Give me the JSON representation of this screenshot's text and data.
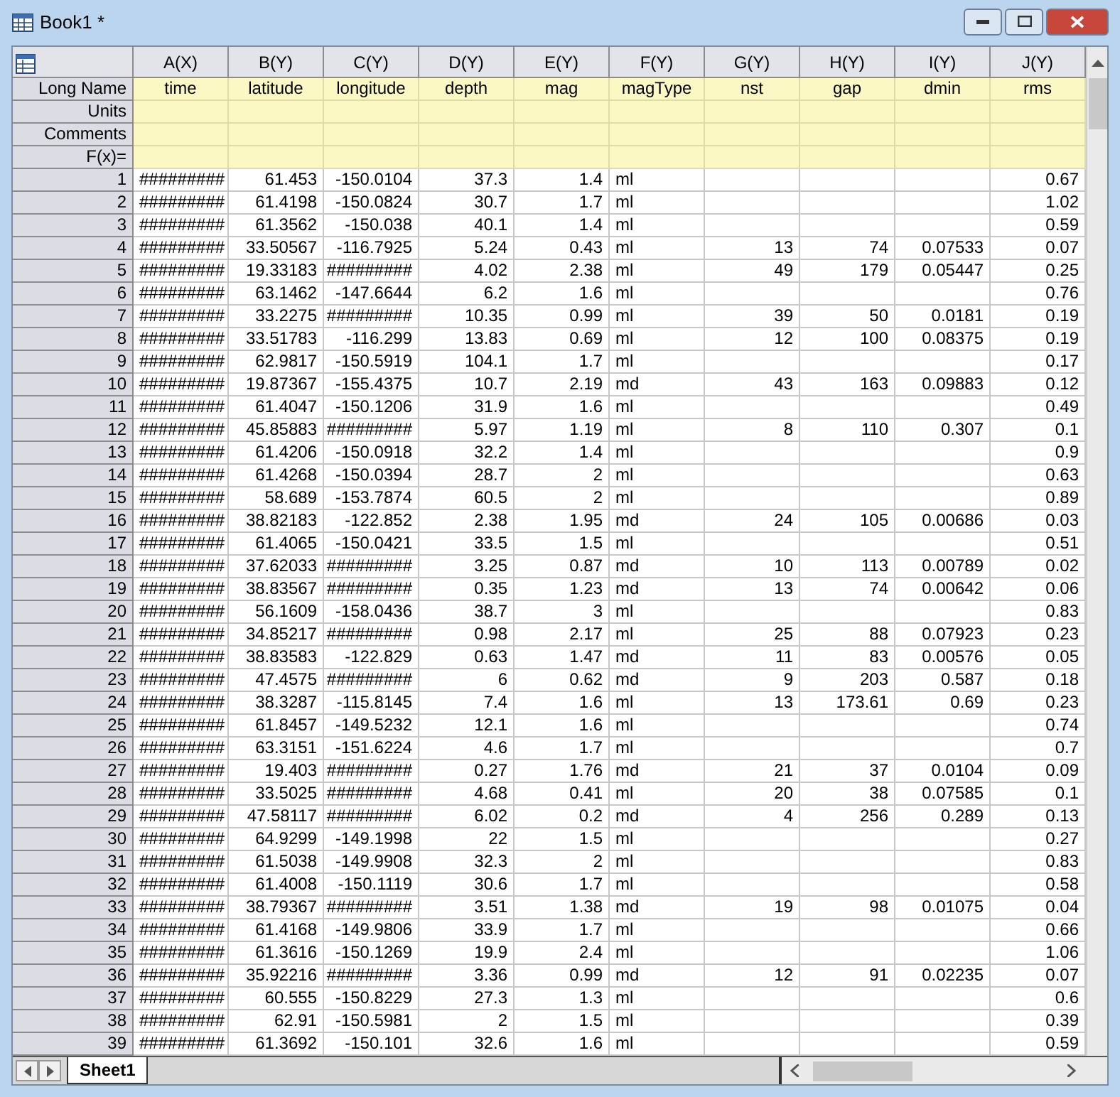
{
  "window": {
    "title": "Book1 *"
  },
  "columns": [
    {
      "name": "A(X)",
      "long_name": "time",
      "kind": "date"
    },
    {
      "name": "B(Y)",
      "long_name": "latitude",
      "kind": "number"
    },
    {
      "name": "C(Y)",
      "long_name": "longitude",
      "kind": "number"
    },
    {
      "name": "D(Y)",
      "long_name": "depth",
      "kind": "number"
    },
    {
      "name": "E(Y)",
      "long_name": "mag",
      "kind": "number"
    },
    {
      "name": "F(Y)",
      "long_name": "magType",
      "kind": "text"
    },
    {
      "name": "G(Y)",
      "long_name": "nst",
      "kind": "number"
    },
    {
      "name": "H(Y)",
      "long_name": "gap",
      "kind": "number"
    },
    {
      "name": "I(Y)",
      "long_name": "dmin",
      "kind": "number"
    },
    {
      "name": "J(Y)",
      "long_name": "rms",
      "kind": "number"
    }
  ],
  "label_rows": [
    "Long Name",
    "Units",
    "Comments",
    "F(x)="
  ],
  "rows": [
    {
      "n": "1",
      "cells": [
        "#########",
        "61.453",
        "-150.0104",
        "37.3",
        "1.4",
        "ml",
        null,
        null,
        null,
        "0.67"
      ]
    },
    {
      "n": "2",
      "cells": [
        "#########",
        "61.4198",
        "-150.0824",
        "30.7",
        "1.7",
        "ml",
        null,
        null,
        null,
        "1.02"
      ]
    },
    {
      "n": "3",
      "cells": [
        "#########",
        "61.3562",
        "-150.038",
        "40.1",
        "1.4",
        "ml",
        null,
        null,
        null,
        "0.59"
      ]
    },
    {
      "n": "4",
      "cells": [
        "#########",
        "33.50567",
        "-116.7925",
        "5.24",
        "0.43",
        "ml",
        "13",
        "74",
        "0.07533",
        "0.07"
      ]
    },
    {
      "n": "5",
      "cells": [
        "#########",
        "19.33183",
        "#########",
        "4.02",
        "2.38",
        "ml",
        "49",
        "179",
        "0.05447",
        "0.25"
      ]
    },
    {
      "n": "6",
      "cells": [
        "#########",
        "63.1462",
        "-147.6644",
        "6.2",
        "1.6",
        "ml",
        null,
        null,
        null,
        "0.76"
      ]
    },
    {
      "n": "7",
      "cells": [
        "#########",
        "33.2275",
        "#########",
        "10.35",
        "0.99",
        "ml",
        "39",
        "50",
        "0.0181",
        "0.19"
      ]
    },
    {
      "n": "8",
      "cells": [
        "#########",
        "33.51783",
        "-116.299",
        "13.83",
        "0.69",
        "ml",
        "12",
        "100",
        "0.08375",
        "0.19"
      ]
    },
    {
      "n": "9",
      "cells": [
        "#########",
        "62.9817",
        "-150.5919",
        "104.1",
        "1.7",
        "ml",
        null,
        null,
        null,
        "0.17"
      ]
    },
    {
      "n": "10",
      "cells": [
        "#########",
        "19.87367",
        "-155.4375",
        "10.7",
        "2.19",
        "md",
        "43",
        "163",
        "0.09883",
        "0.12"
      ]
    },
    {
      "n": "11",
      "cells": [
        "#########",
        "61.4047",
        "-150.1206",
        "31.9",
        "1.6",
        "ml",
        null,
        null,
        null,
        "0.49"
      ]
    },
    {
      "n": "12",
      "cells": [
        "#########",
        "45.85883",
        "#########",
        "5.97",
        "1.19",
        "ml",
        "8",
        "110",
        "0.307",
        "0.1"
      ]
    },
    {
      "n": "13",
      "cells": [
        "#########",
        "61.4206",
        "-150.0918",
        "32.2",
        "1.4",
        "ml",
        null,
        null,
        null,
        "0.9"
      ]
    },
    {
      "n": "14",
      "cells": [
        "#########",
        "61.4268",
        "-150.0394",
        "28.7",
        "2",
        "ml",
        null,
        null,
        null,
        "0.63"
      ]
    },
    {
      "n": "15",
      "cells": [
        "#########",
        "58.689",
        "-153.7874",
        "60.5",
        "2",
        "ml",
        null,
        null,
        null,
        "0.89"
      ]
    },
    {
      "n": "16",
      "cells": [
        "#########",
        "38.82183",
        "-122.852",
        "2.38",
        "1.95",
        "md",
        "24",
        "105",
        "0.00686",
        "0.03"
      ]
    },
    {
      "n": "17",
      "cells": [
        "#########",
        "61.4065",
        "-150.0421",
        "33.5",
        "1.5",
        "ml",
        null,
        null,
        null,
        "0.51"
      ]
    },
    {
      "n": "18",
      "cells": [
        "#########",
        "37.62033",
        "#########",
        "3.25",
        "0.87",
        "md",
        "10",
        "113",
        "0.00789",
        "0.02"
      ]
    },
    {
      "n": "19",
      "cells": [
        "#########",
        "38.83567",
        "#########",
        "0.35",
        "1.23",
        "md",
        "13",
        "74",
        "0.00642",
        "0.06"
      ]
    },
    {
      "n": "20",
      "cells": [
        "#########",
        "56.1609",
        "-158.0436",
        "38.7",
        "3",
        "ml",
        null,
        null,
        null,
        "0.83"
      ]
    },
    {
      "n": "21",
      "cells": [
        "#########",
        "34.85217",
        "#########",
        "0.98",
        "2.17",
        "ml",
        "25",
        "88",
        "0.07923",
        "0.23"
      ]
    },
    {
      "n": "22",
      "cells": [
        "#########",
        "38.83583",
        "-122.829",
        "0.63",
        "1.47",
        "md",
        "11",
        "83",
        "0.00576",
        "0.05"
      ]
    },
    {
      "n": "23",
      "cells": [
        "#########",
        "47.4575",
        "#########",
        "6",
        "0.62",
        "md",
        "9",
        "203",
        "0.587",
        "0.18"
      ]
    },
    {
      "n": "24",
      "cells": [
        "#########",
        "38.3287",
        "-115.8145",
        "7.4",
        "1.6",
        "ml",
        "13",
        "173.61",
        "0.69",
        "0.23"
      ]
    },
    {
      "n": "25",
      "cells": [
        "#########",
        "61.8457",
        "-149.5232",
        "12.1",
        "1.6",
        "ml",
        null,
        null,
        null,
        "0.74"
      ]
    },
    {
      "n": "26",
      "cells": [
        "#########",
        "63.3151",
        "-151.6224",
        "4.6",
        "1.7",
        "ml",
        null,
        null,
        null,
        "0.7"
      ]
    },
    {
      "n": "27",
      "cells": [
        "#########",
        "19.403",
        "#########",
        "0.27",
        "1.76",
        "md",
        "21",
        "37",
        "0.0104",
        "0.09"
      ]
    },
    {
      "n": "28",
      "cells": [
        "#########",
        "33.5025",
        "#########",
        "4.68",
        "0.41",
        "ml",
        "20",
        "38",
        "0.07585",
        "0.1"
      ]
    },
    {
      "n": "29",
      "cells": [
        "#########",
        "47.58117",
        "#########",
        "6.02",
        "0.2",
        "md",
        "4",
        "256",
        "0.289",
        "0.13"
      ]
    },
    {
      "n": "30",
      "cells": [
        "#########",
        "64.9299",
        "-149.1998",
        "22",
        "1.5",
        "ml",
        null,
        null,
        null,
        "0.27"
      ]
    },
    {
      "n": "31",
      "cells": [
        "#########",
        "61.5038",
        "-149.9908",
        "32.3",
        "2",
        "ml",
        null,
        null,
        null,
        "0.83"
      ]
    },
    {
      "n": "32",
      "cells": [
        "#########",
        "61.4008",
        "-150.1119",
        "30.6",
        "1.7",
        "ml",
        null,
        null,
        null,
        "0.58"
      ]
    },
    {
      "n": "33",
      "cells": [
        "#########",
        "38.79367",
        "#########",
        "3.51",
        "1.38",
        "md",
        "19",
        "98",
        "0.01075",
        "0.04"
      ]
    },
    {
      "n": "34",
      "cells": [
        "#########",
        "61.4168",
        "-149.9806",
        "33.9",
        "1.7",
        "ml",
        null,
        null,
        null,
        "0.66"
      ]
    },
    {
      "n": "35",
      "cells": [
        "#########",
        "61.3616",
        "-150.1269",
        "19.9",
        "2.4",
        "ml",
        null,
        null,
        null,
        "1.06"
      ]
    },
    {
      "n": "36",
      "cells": [
        "#########",
        "35.92216",
        "#########",
        "3.36",
        "0.99",
        "md",
        "12",
        "91",
        "0.02235",
        "0.07"
      ]
    },
    {
      "n": "37",
      "cells": [
        "#########",
        "60.555",
        "-150.8229",
        "27.3",
        "1.3",
        "ml",
        null,
        null,
        null,
        "0.6"
      ]
    },
    {
      "n": "38",
      "cells": [
        "#########",
        "62.91",
        "-150.5981",
        "2",
        "1.5",
        "ml",
        null,
        null,
        null,
        "0.39"
      ]
    },
    {
      "n": "39",
      "cells": [
        "#########",
        "61.3692",
        "-150.101",
        "32.6",
        "1.6",
        "ml",
        null,
        null,
        null,
        "0.59"
      ]
    }
  ],
  "sheet_tabs": [
    {
      "label": "Sheet1",
      "selected": true
    }
  ]
}
